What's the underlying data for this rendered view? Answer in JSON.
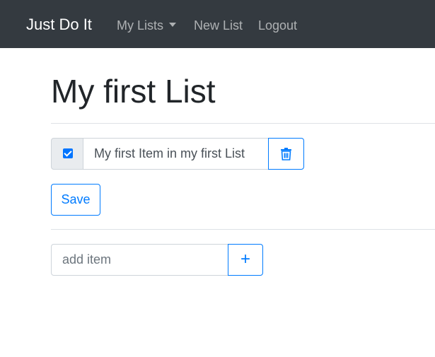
{
  "navbar": {
    "brand": "Just Do It",
    "links": [
      {
        "label": "My Lists",
        "dropdown": true
      },
      {
        "label": "New List"
      },
      {
        "label": "Logout"
      }
    ],
    "background": "#343a40"
  },
  "list": {
    "title": "My first List",
    "items": [
      {
        "text": "My first Item in my first List",
        "checked": true
      }
    ],
    "save_label": "Save"
  },
  "add_item": {
    "placeholder": "add item",
    "button_label": "+"
  },
  "colors": {
    "accent": "#007bff",
    "checkbox": "#0075ff"
  }
}
